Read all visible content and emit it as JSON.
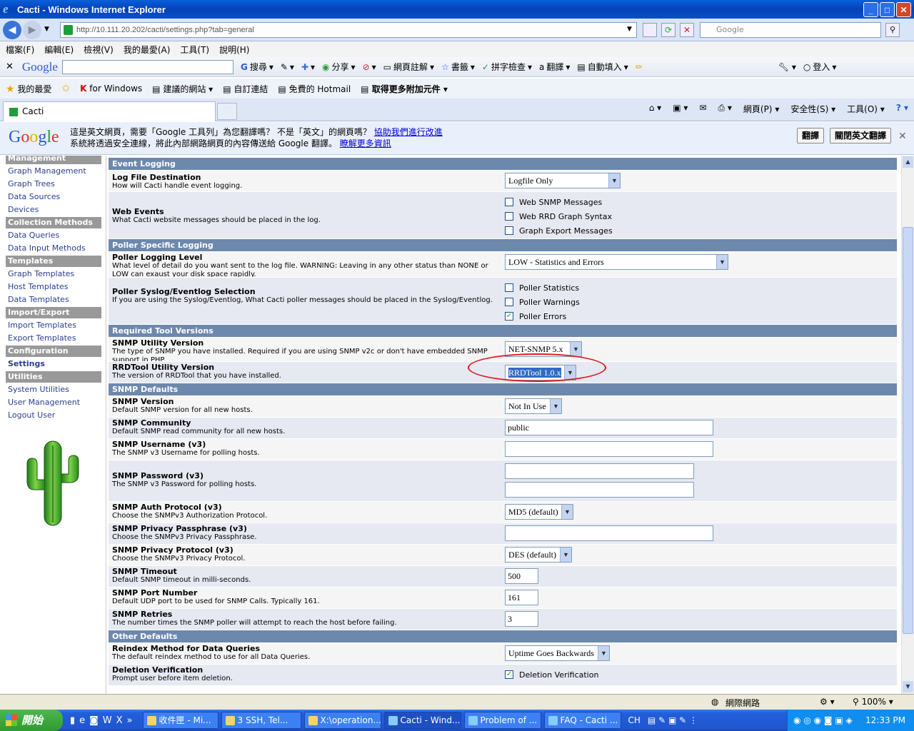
{
  "window": {
    "title": "Cacti - Windows Internet Explorer"
  },
  "address": {
    "url": "http://10.111.20.202/cacti/settings.php?tab=general",
    "search_placeholder": "Google"
  },
  "menu": [
    "檔案(F)",
    "編輯(E)",
    "檢視(V)",
    "我的最愛(A)",
    "工具(T)",
    "說明(H)"
  ],
  "google_toolbar": {
    "brand": "Google",
    "items": [
      "搜尋",
      "分享",
      "網頁註解",
      "書籤",
      "拼字檢查",
      "翻譯",
      "自動填入",
      "登入"
    ]
  },
  "favorites": {
    "label": "我的最愛",
    "items": [
      "for Windows",
      "建議的網站",
      "自訂連結",
      "免費的 Hotmail",
      "取得更多附加元件"
    ]
  },
  "tab": {
    "title": "Cacti"
  },
  "cmdbar": [
    "網頁(P)",
    "安全性(S)",
    "工具(O)"
  ],
  "translate": {
    "line1": "這是英文網頁，需要「Google 工具列」為您翻譯嗎？ 不是「英文」的網頁嗎？",
    "link1": "協助我們進行改進",
    "line2": "系統將透過安全連線，將此內部網路網頁的內容傳送給 Google 翻譯。",
    "link2": "瞭解更多資訊",
    "translate_btn": "翻譯",
    "close_btn": "關閉英文翻譯"
  },
  "sidebar": {
    "sections": [
      {
        "header": "Management",
        "items": [
          "Graph Management",
          "Graph Trees",
          "Data Sources",
          "Devices"
        ]
      },
      {
        "header": "Collection Methods",
        "items": [
          "Data Queries",
          "Data Input Methods"
        ]
      },
      {
        "header": "Templates",
        "items": [
          "Graph Templates",
          "Host Templates",
          "Data Templates"
        ]
      },
      {
        "header": "Import/Export",
        "items": [
          "Import Templates",
          "Export Templates"
        ]
      },
      {
        "header": "Configuration",
        "items": [
          "Settings"
        ]
      },
      {
        "header": "Utilities",
        "items": [
          "System Utilities",
          "User Management",
          "Logout User"
        ]
      }
    ]
  },
  "settings": {
    "event_logging": "Event Logging",
    "log_dest": {
      "title": "Log File Destination",
      "desc": "How will Cacti handle event logging.",
      "value": "Logfile Only"
    },
    "web_events": {
      "title": "Web Events",
      "desc": "What Cacti website messages should be placed in the log.",
      "options": [
        "Web SNMP Messages",
        "Web RRD Graph Syntax",
        "Graph Export Messages"
      ]
    },
    "poller_logging": "Poller Specific Logging",
    "poller_level": {
      "title": "Poller Logging Level",
      "desc": "What level of detail do you want sent to the log file. WARNING: Leaving in any other status than NONE or LOW can exaust your disk space rapidly.",
      "value": "LOW - Statistics and Errors"
    },
    "poller_syslog": {
      "title": "Poller Syslog/Eventlog Selection",
      "desc": "If you are using the Syslog/Eventlog, What Cacti poller messages should be placed in the Syslog/Eventlog.",
      "options": [
        "Poller Statistics",
        "Poller Warnings",
        "Poller Errors"
      ]
    },
    "tool_versions": "Required Tool Versions",
    "snmp_utility": {
      "title": "SNMP Utility Version",
      "desc": "The type of SNMP you have installed. Required if you are using SNMP v2c or don't have embedded SNMP support in PHP.",
      "value": "NET-SNMP 5.x"
    },
    "rrdtool": {
      "title": "RRDTool Utility Version",
      "desc": "The version of RRDTool that you have installed.",
      "value": "RRDTool 1.0.x"
    },
    "snmp_defaults": "SNMP Defaults",
    "snmp_version": {
      "title": "SNMP Version",
      "desc": "Default SNMP version for all new hosts.",
      "value": "Not In Use"
    },
    "snmp_community": {
      "title": "SNMP Community",
      "desc": "Default SNMP read community for all new hosts.",
      "value": "public"
    },
    "snmp_username": {
      "title": "SNMP Username (v3)",
      "desc": "The SNMP v3 Username for polling hosts.",
      "value": ""
    },
    "snmp_password": {
      "title": "SNMP Password (v3)",
      "desc": "The SNMP v3 Password for polling hosts."
    },
    "snmp_auth": {
      "title": "SNMP Auth Protocol (v3)",
      "desc": "Choose the SNMPv3 Authorization Protocol.",
      "value": "MD5 (default)"
    },
    "snmp_priv_pass": {
      "title": "SNMP Privacy Passphrase (v3)",
      "desc": "Choose the SNMPv3 Privacy Passphrase.",
      "value": ""
    },
    "snmp_priv_proto": {
      "title": "SNMP Privacy Protocol (v3)",
      "desc": "Choose the SNMPv3 Privacy Protocol.",
      "value": "DES (default)"
    },
    "snmp_timeout": {
      "title": "SNMP Timeout",
      "desc": "Default SNMP timeout in milli-seconds.",
      "value": "500"
    },
    "snmp_port": {
      "title": "SNMP Port Number",
      "desc": "Default UDP port to be used for SNMP Calls. Typically 161.",
      "value": "161"
    },
    "snmp_retries": {
      "title": "SNMP Retries",
      "desc": "The number times the SNMP poller will attempt to reach the host before failing.",
      "value": "3"
    },
    "other_defaults": "Other Defaults",
    "reindex": {
      "title": "Reindex Method for Data Queries",
      "desc": "The default reindex method to use for all Data Queries.",
      "value": "Uptime Goes Backwards"
    },
    "deletion": {
      "title": "Deletion Verification",
      "desc": "Prompt user before item deletion.",
      "option": "Deletion Verification"
    }
  },
  "statusbar": {
    "zone": "網際網路",
    "zoom": "100%"
  },
  "taskbar": {
    "start": "開始",
    "tasks": [
      "收件匣 - Mi...",
      "3 SSH, Tel...",
      "X:\\operation...",
      "Cacti - Wind...",
      "Problem of ...",
      "FAQ - Cacti ..."
    ],
    "lang": "CH",
    "time": "12:33 PM"
  }
}
